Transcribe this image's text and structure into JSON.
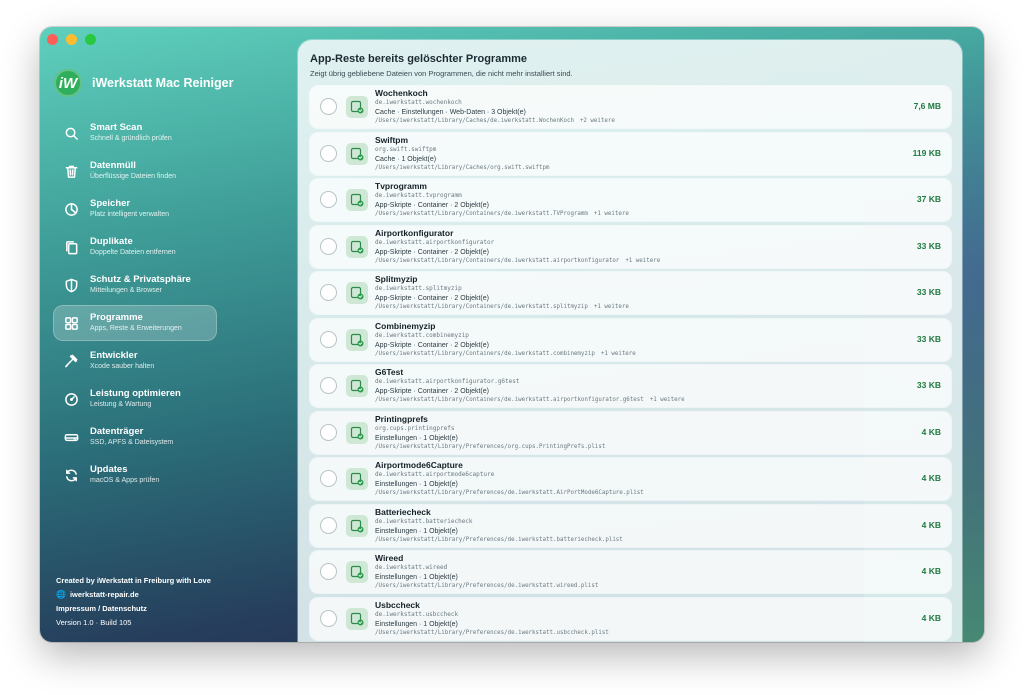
{
  "window": {
    "controls": [
      "close",
      "minimize",
      "maximize"
    ]
  },
  "brand": {
    "logo_letter": "iW",
    "title": "iWerkstatt Mac Reiniger"
  },
  "sidebar": {
    "items": [
      {
        "title": "Smart Scan",
        "subtitle": "Schnell & gründlich prüfen",
        "icon": "search-icon"
      },
      {
        "title": "Datenmüll",
        "subtitle": "Überflüssige Dateien finden",
        "icon": "trash-icon"
      },
      {
        "title": "Speicher",
        "subtitle": "Platz intelligent verwalten",
        "icon": "pie-chart-icon"
      },
      {
        "title": "Duplikate",
        "subtitle": "Doppelte Dateien entfernen",
        "icon": "duplicate-icon"
      },
      {
        "title": "Schutz & Privatsphäre",
        "subtitle": "Mitteilungen & Browser",
        "icon": "shield-icon"
      },
      {
        "title": "Programme",
        "subtitle": "Apps, Reste & Erweiterungen",
        "icon": "grid-icon",
        "active": true
      },
      {
        "title": "Entwickler",
        "subtitle": "Xcode sauber halten",
        "icon": "hammer-icon"
      },
      {
        "title": "Leistung optimieren",
        "subtitle": "Leistung & Wartung",
        "icon": "gauge-icon"
      },
      {
        "title": "Datenträger",
        "subtitle": "SSD, APFS & Dateisystem",
        "icon": "drive-icon"
      },
      {
        "title": "Updates",
        "subtitle": "macOS & Apps prüfen",
        "icon": "refresh-icon"
      }
    ]
  },
  "footer": {
    "credit": "Created by iWerkstatt in Freiburg with Love",
    "website": "iwerkstatt-repair.de",
    "legal": "Impressum / Datenschutz",
    "version": "Version 1.0 · Build 105"
  },
  "main": {
    "title": "App-Reste bereits gelöschter Programme",
    "subtitle": "Zeigt übrig gebliebene Dateien von Programmen, die nicht mehr installiert sind.",
    "items": [
      {
        "name": "Wochenkoch",
        "bundle": "de.iwerkstatt.wochenkoch",
        "category": "Cache · Einstellungen · Web-Daten · 3 Objekt(e)",
        "path": "/Users/iwerkstatt/Library/Caches/de.iwerkstatt.WochenKoch",
        "more": "+2 weitere",
        "size": "7,6 MB"
      },
      {
        "name": "Swiftpm",
        "bundle": "org.swift.swiftpm",
        "category": "Cache · 1 Objekt(e)",
        "path": "/Users/iwerkstatt/Library/Caches/org.swift.swiftpm",
        "more": "",
        "size": "119 KB"
      },
      {
        "name": "Tvprogramm",
        "bundle": "de.iwerkstatt.tvprogramm",
        "category": "App-Skripte · Container · 2 Objekt(e)",
        "path": "/Users/iwerkstatt/Library/Containers/de.iwerkstatt.TVProgramm",
        "more": "+1 weitere",
        "size": "37 KB"
      },
      {
        "name": "Airportkonfigurator",
        "bundle": "de.iwerkstatt.airportkonfigurator",
        "category": "App-Skripte · Container · 2 Objekt(e)",
        "path": "/Users/iwerkstatt/Library/Containers/de.iwerkstatt.airportkonfigurator",
        "more": "+1 weitere",
        "size": "33 KB"
      },
      {
        "name": "Splitmyzip",
        "bundle": "de.iwerkstatt.splitmyzip",
        "category": "App-Skripte · Container · 2 Objekt(e)",
        "path": "/Users/iwerkstatt/Library/Containers/de.iwerkstatt.splitmyzip",
        "more": "+1 weitere",
        "size": "33 KB"
      },
      {
        "name": "Combinemyzip",
        "bundle": "de.iwerkstatt.combinemyzip",
        "category": "App-Skripte · Container · 2 Objekt(e)",
        "path": "/Users/iwerkstatt/Library/Containers/de.iwerkstatt.combinemyzip",
        "more": "+1 weitere",
        "size": "33 KB"
      },
      {
        "name": "G6Test",
        "bundle": "de.iwerkstatt.airportkonfigurator.g6test",
        "category": "App-Skripte · Container · 2 Objekt(e)",
        "path": "/Users/iwerkstatt/Library/Containers/de.iwerkstatt.airportkonfigurator.g6test",
        "more": "+1 weitere",
        "size": "33 KB"
      },
      {
        "name": "Printingprefs",
        "bundle": "org.cups.printingprefs",
        "category": "Einstellungen · 1 Objekt(e)",
        "path": "/Users/iwerkstatt/Library/Preferences/org.cups.PrintingPrefs.plist",
        "more": "",
        "size": "4 KB"
      },
      {
        "name": "Airportmode6Capture",
        "bundle": "de.iwerkstatt.airportmode6capture",
        "category": "Einstellungen · 1 Objekt(e)",
        "path": "/Users/iwerkstatt/Library/Preferences/de.iwerkstatt.AirPortMode6Capture.plist",
        "more": "",
        "size": "4 KB"
      },
      {
        "name": "Batteriecheck",
        "bundle": "de.iwerkstatt.batteriecheck",
        "category": "Einstellungen · 1 Objekt(e)",
        "path": "/Users/iwerkstatt/Library/Preferences/de.iwerkstatt.batteriecheck.plist",
        "more": "",
        "size": "4 KB"
      },
      {
        "name": "Wireed",
        "bundle": "de.iwerkstatt.wireed",
        "category": "Einstellungen · 1 Objekt(e)",
        "path": "/Users/iwerkstatt/Library/Preferences/de.iwerkstatt.wireed.plist",
        "more": "",
        "size": "4 KB"
      },
      {
        "name": "Usbccheck",
        "bundle": "de.iwerkstatt.usbccheck",
        "category": "Einstellungen · 1 Objekt(e)",
        "path": "/Users/iwerkstatt/Library/Preferences/de.iwerkstatt.usbccheck.plist",
        "more": "",
        "size": "4 KB"
      }
    ]
  },
  "colors": {
    "accent_green": "#1f7a3f",
    "row_icon_bg": "#cfe8d6"
  }
}
